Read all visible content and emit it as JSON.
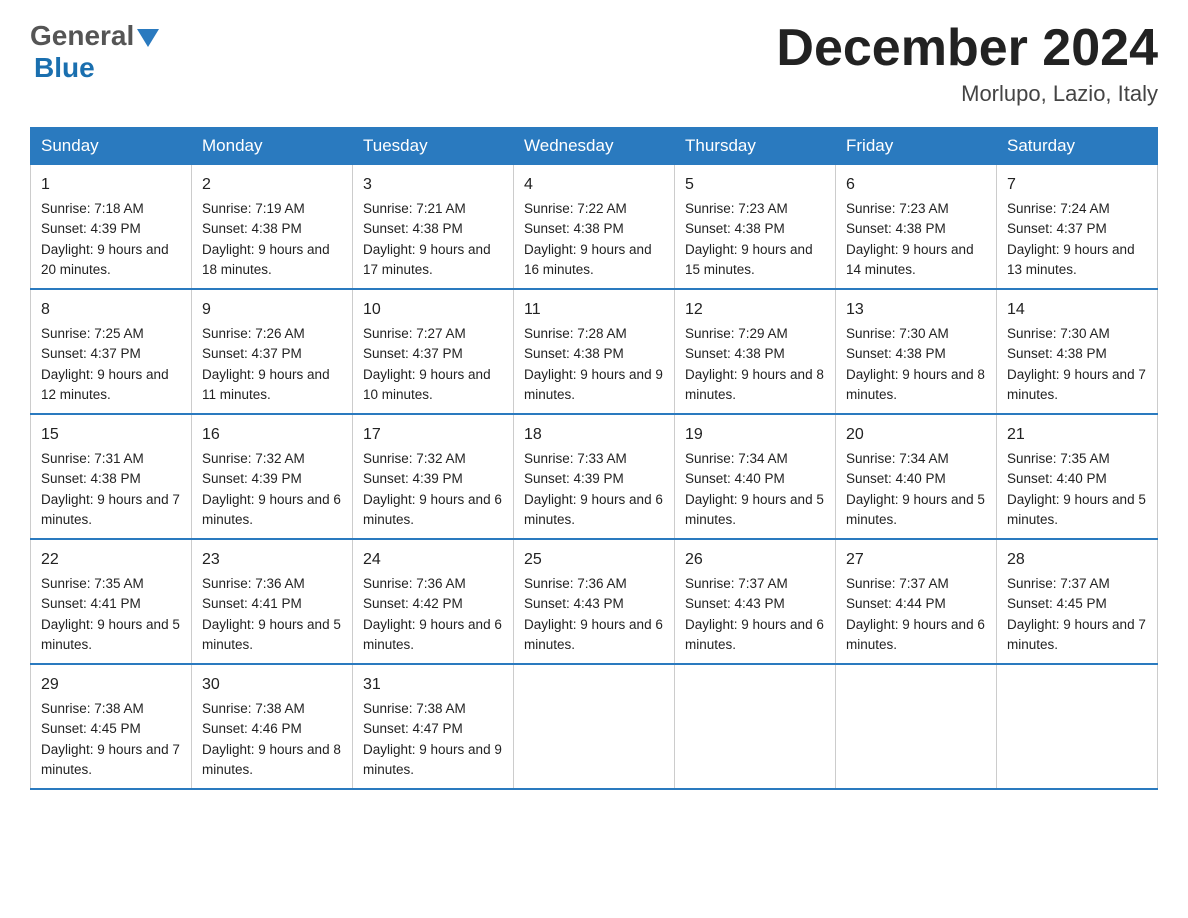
{
  "header": {
    "logo_general": "General",
    "logo_blue": "Blue",
    "month_title": "December 2024",
    "location": "Morlupo, Lazio, Italy"
  },
  "weekdays": [
    "Sunday",
    "Monday",
    "Tuesday",
    "Wednesday",
    "Thursday",
    "Friday",
    "Saturday"
  ],
  "weeks": [
    [
      {
        "day": "1",
        "sunrise": "7:18 AM",
        "sunset": "4:39 PM",
        "daylight": "9 hours and 20 minutes."
      },
      {
        "day": "2",
        "sunrise": "7:19 AM",
        "sunset": "4:38 PM",
        "daylight": "9 hours and 18 minutes."
      },
      {
        "day": "3",
        "sunrise": "7:21 AM",
        "sunset": "4:38 PM",
        "daylight": "9 hours and 17 minutes."
      },
      {
        "day": "4",
        "sunrise": "7:22 AM",
        "sunset": "4:38 PM",
        "daylight": "9 hours and 16 minutes."
      },
      {
        "day": "5",
        "sunrise": "7:23 AM",
        "sunset": "4:38 PM",
        "daylight": "9 hours and 15 minutes."
      },
      {
        "day": "6",
        "sunrise": "7:23 AM",
        "sunset": "4:38 PM",
        "daylight": "9 hours and 14 minutes."
      },
      {
        "day": "7",
        "sunrise": "7:24 AM",
        "sunset": "4:37 PM",
        "daylight": "9 hours and 13 minutes."
      }
    ],
    [
      {
        "day": "8",
        "sunrise": "7:25 AM",
        "sunset": "4:37 PM",
        "daylight": "9 hours and 12 minutes."
      },
      {
        "day": "9",
        "sunrise": "7:26 AM",
        "sunset": "4:37 PM",
        "daylight": "9 hours and 11 minutes."
      },
      {
        "day": "10",
        "sunrise": "7:27 AM",
        "sunset": "4:37 PM",
        "daylight": "9 hours and 10 minutes."
      },
      {
        "day": "11",
        "sunrise": "7:28 AM",
        "sunset": "4:38 PM",
        "daylight": "9 hours and 9 minutes."
      },
      {
        "day": "12",
        "sunrise": "7:29 AM",
        "sunset": "4:38 PM",
        "daylight": "9 hours and 8 minutes."
      },
      {
        "day": "13",
        "sunrise": "7:30 AM",
        "sunset": "4:38 PM",
        "daylight": "9 hours and 8 minutes."
      },
      {
        "day": "14",
        "sunrise": "7:30 AM",
        "sunset": "4:38 PM",
        "daylight": "9 hours and 7 minutes."
      }
    ],
    [
      {
        "day": "15",
        "sunrise": "7:31 AM",
        "sunset": "4:38 PM",
        "daylight": "9 hours and 7 minutes."
      },
      {
        "day": "16",
        "sunrise": "7:32 AM",
        "sunset": "4:39 PM",
        "daylight": "9 hours and 6 minutes."
      },
      {
        "day": "17",
        "sunrise": "7:32 AM",
        "sunset": "4:39 PM",
        "daylight": "9 hours and 6 minutes."
      },
      {
        "day": "18",
        "sunrise": "7:33 AM",
        "sunset": "4:39 PM",
        "daylight": "9 hours and 6 minutes."
      },
      {
        "day": "19",
        "sunrise": "7:34 AM",
        "sunset": "4:40 PM",
        "daylight": "9 hours and 5 minutes."
      },
      {
        "day": "20",
        "sunrise": "7:34 AM",
        "sunset": "4:40 PM",
        "daylight": "9 hours and 5 minutes."
      },
      {
        "day": "21",
        "sunrise": "7:35 AM",
        "sunset": "4:40 PM",
        "daylight": "9 hours and 5 minutes."
      }
    ],
    [
      {
        "day": "22",
        "sunrise": "7:35 AM",
        "sunset": "4:41 PM",
        "daylight": "9 hours and 5 minutes."
      },
      {
        "day": "23",
        "sunrise": "7:36 AM",
        "sunset": "4:41 PM",
        "daylight": "9 hours and 5 minutes."
      },
      {
        "day": "24",
        "sunrise": "7:36 AM",
        "sunset": "4:42 PM",
        "daylight": "9 hours and 6 minutes."
      },
      {
        "day": "25",
        "sunrise": "7:36 AM",
        "sunset": "4:43 PM",
        "daylight": "9 hours and 6 minutes."
      },
      {
        "day": "26",
        "sunrise": "7:37 AM",
        "sunset": "4:43 PM",
        "daylight": "9 hours and 6 minutes."
      },
      {
        "day": "27",
        "sunrise": "7:37 AM",
        "sunset": "4:44 PM",
        "daylight": "9 hours and 6 minutes."
      },
      {
        "day": "28",
        "sunrise": "7:37 AM",
        "sunset": "4:45 PM",
        "daylight": "9 hours and 7 minutes."
      }
    ],
    [
      {
        "day": "29",
        "sunrise": "7:38 AM",
        "sunset": "4:45 PM",
        "daylight": "9 hours and 7 minutes."
      },
      {
        "day": "30",
        "sunrise": "7:38 AM",
        "sunset": "4:46 PM",
        "daylight": "9 hours and 8 minutes."
      },
      {
        "day": "31",
        "sunrise": "7:38 AM",
        "sunset": "4:47 PM",
        "daylight": "9 hours and 9 minutes."
      },
      null,
      null,
      null,
      null
    ]
  ],
  "labels": {
    "sunrise": "Sunrise:",
    "sunset": "Sunset:",
    "daylight": "Daylight:"
  }
}
